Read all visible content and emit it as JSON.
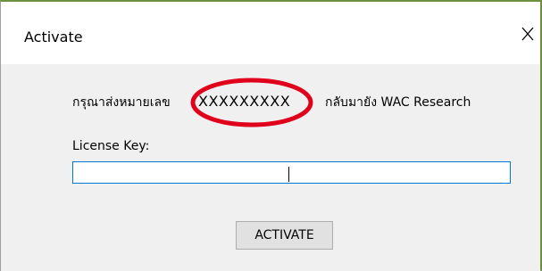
{
  "window": {
    "title": "Activate",
    "close_glyph": "close-icon"
  },
  "message": {
    "prefix": "กรุณาส่งหมายเลข",
    "code": "XXXXXXXXX",
    "suffix": "กลับมายัง WAC Research"
  },
  "license": {
    "label": "License Key:",
    "value": "",
    "placeholder": ""
  },
  "buttons": {
    "activate_label": "ACTIVATE"
  },
  "colors": {
    "highlight_ring": "#e0001b",
    "input_border": "#0078d7",
    "dialog_background": "#f0f0f0"
  }
}
